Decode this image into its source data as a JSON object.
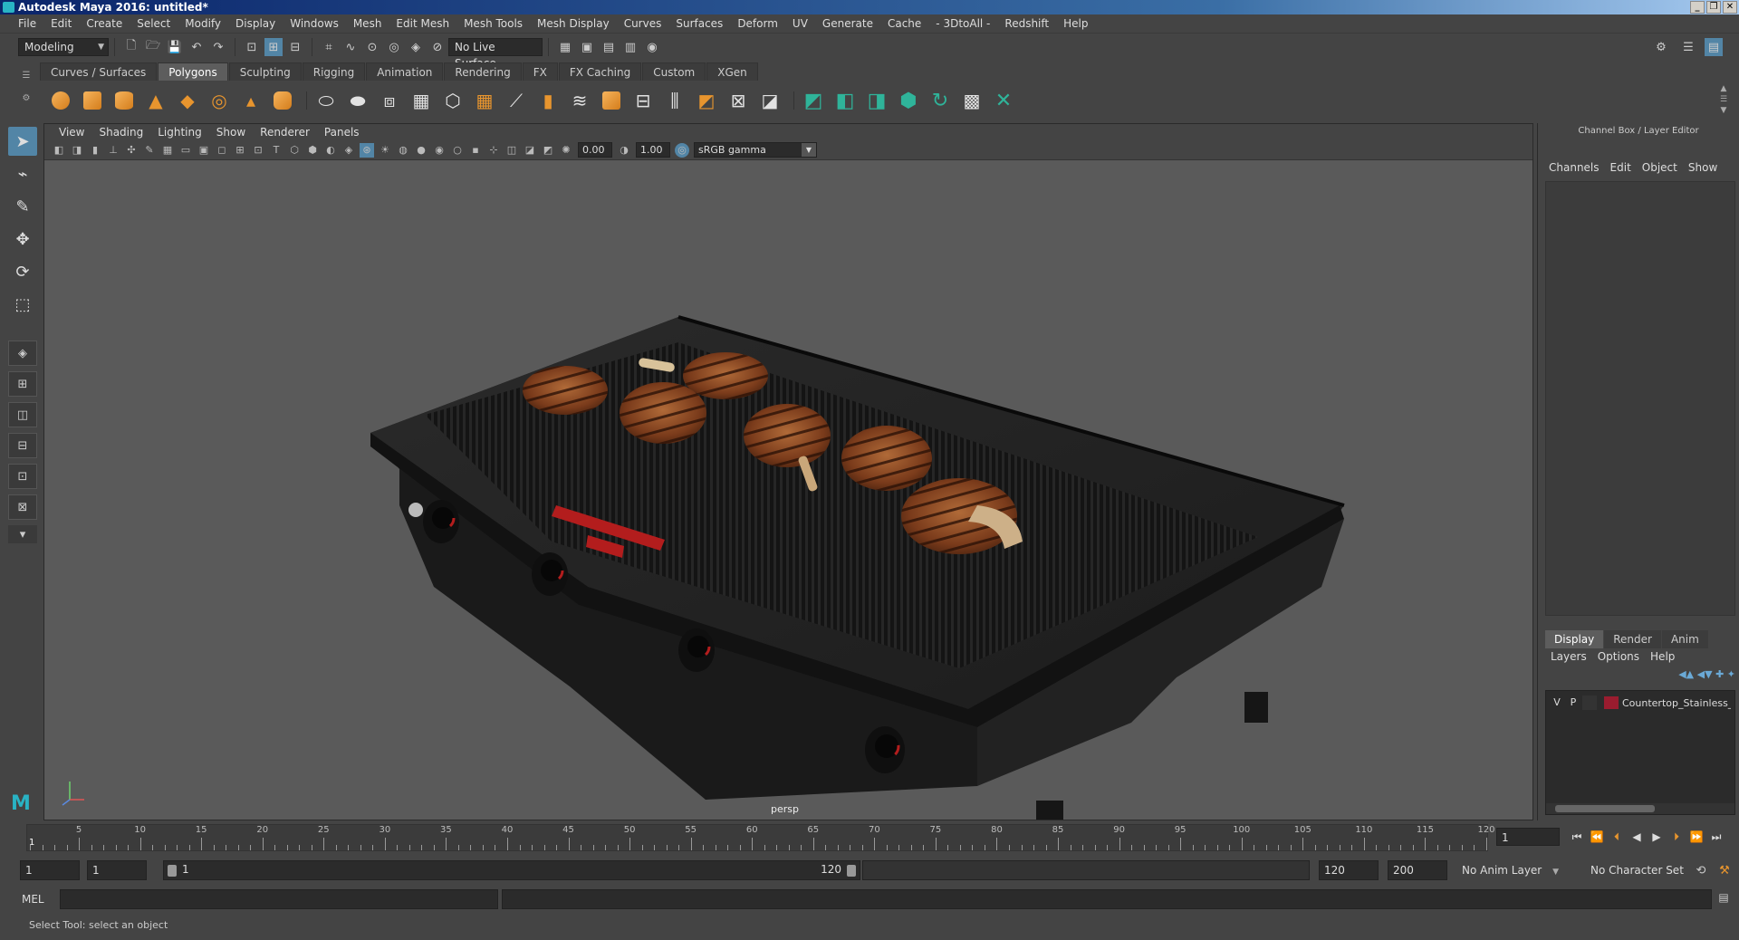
{
  "window": {
    "title": "Autodesk Maya 2016: untitled*",
    "controls": [
      "_",
      "❐",
      "✕"
    ]
  },
  "menubar": [
    "File",
    "Edit",
    "Create",
    "Select",
    "Modify",
    "Display",
    "Windows",
    "Mesh",
    "Edit Mesh",
    "Mesh Tools",
    "Mesh Display",
    "Curves",
    "Surfaces",
    "Deform",
    "UV",
    "Generate",
    "Cache",
    "- 3DtoAll -",
    "Redshift",
    "Help"
  ],
  "statusline": {
    "mode": "Modeling",
    "live_surface": "No Live Surface"
  },
  "shelf": {
    "tabs": [
      "Curves / Surfaces",
      "Polygons",
      "Sculpting",
      "Rigging",
      "Animation",
      "Rendering",
      "FX",
      "FX Caching",
      "Custom",
      "XGen"
    ],
    "active_tab": "Polygons"
  },
  "viewport": {
    "menu": [
      "View",
      "Shading",
      "Lighting",
      "Show",
      "Renderer",
      "Panels"
    ],
    "exposure": "0.00",
    "gamma_value": "1.00",
    "color_space": "sRGB gamma",
    "camera": "persp"
  },
  "channel_box": {
    "title": "Channel Box / Layer Editor",
    "menu": [
      "Channels",
      "Edit",
      "Object",
      "Show"
    ],
    "layer_tabs": [
      "Display",
      "Render",
      "Anim"
    ],
    "active_layer_tab": "Display",
    "layer_menu": [
      "Layers",
      "Options",
      "Help"
    ],
    "layers": [
      {
        "visible": "V",
        "playback": "P",
        "color": "#9a1c2f",
        "name": "Countertop_Stainless_S"
      }
    ]
  },
  "timeline": {
    "tick_labels": [
      "5",
      "10",
      "15",
      "20",
      "25",
      "30",
      "35",
      "40",
      "45",
      "50",
      "55",
      "60",
      "65",
      "70",
      "75",
      "80",
      "85",
      "90",
      "95",
      "100",
      "105",
      "110",
      "115",
      "120"
    ],
    "current_frame_marker": "1",
    "current_frame": "1"
  },
  "range": {
    "start": "1",
    "playback_start": "1",
    "slider_start": "1",
    "slider_end": "120",
    "playback_end": "120",
    "end": "200",
    "anim_layer": "No Anim Layer",
    "character_set": "No Character Set"
  },
  "command": {
    "language": "MEL"
  },
  "help_line": "Select Tool: select an object"
}
